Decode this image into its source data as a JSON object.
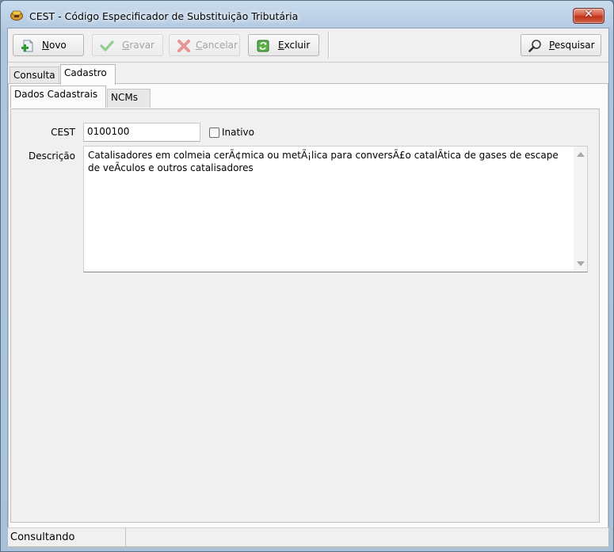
{
  "window": {
    "title": "CEST - Código Especificador de Substituição Tributária",
    "close_label": "✕"
  },
  "toolbar": {
    "novo": {
      "label": "Novo",
      "hotkey": "N",
      "rest": "ovo",
      "icon": "add-document-icon"
    },
    "gravar": {
      "label": "Gravar",
      "hotkey": "G",
      "rest": "ravar",
      "icon": "checkmark-icon"
    },
    "cancelar": {
      "label": "Cancelar",
      "hotkey": "C",
      "rest": "ancelar",
      "icon": "cancel-x-icon"
    },
    "excluir": {
      "label": "Excluir",
      "hotkey": "E",
      "rest": "xcluir",
      "icon": "recycle-icon"
    },
    "pesquisar": {
      "label": "Pesquisar",
      "hotkey": "P",
      "rest": "esquisar",
      "icon": "magnifier-icon"
    }
  },
  "tabs": {
    "consulta": "Consulta",
    "cadastro": "Cadastro"
  },
  "subtabs": {
    "dados": "Dados Cadastrais",
    "ncms": "NCMs"
  },
  "form": {
    "cest_label": "CEST",
    "cest_value": "0100100",
    "inativo_label": "Inativo",
    "inativo_checked": false,
    "descricao_label": "Descrição",
    "descricao_line1": "Catalisadores em colmeia cerÃ¢mica ou metÃ¡lica para conversÃ£o catalÃ­tica de gases de escape",
    "descricao_line2": "de veÃ­culos e outros catalisadores"
  },
  "status": {
    "text": "Consultando"
  },
  "colors": {
    "window_frame": "#b7cde4",
    "close_button": "#c84a31",
    "panel": "#f0f0f0"
  }
}
